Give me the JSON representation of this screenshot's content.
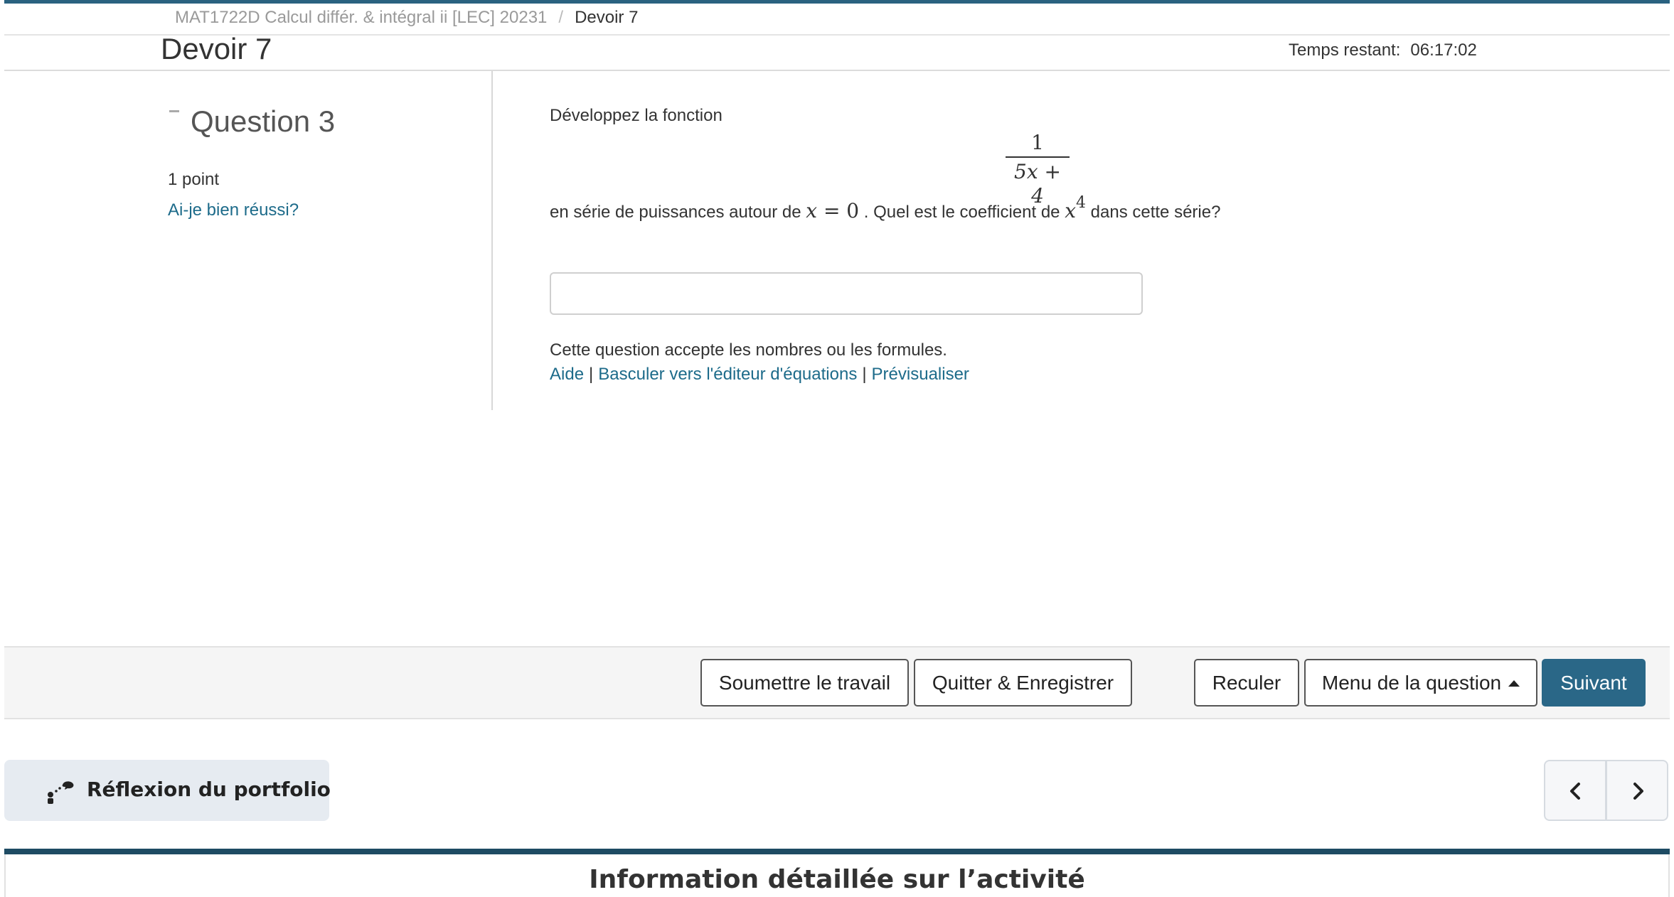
{
  "breadcrumb": {
    "course": "MAT1722D Calcul différ. & intégral ii [LEC] 20231",
    "separator": "/",
    "current": "Devoir 7"
  },
  "header": {
    "title": "Devoir 7",
    "timer_label": "Temps restant:",
    "timer_value": "06:17:02"
  },
  "question_panel": {
    "collapse_symbol": "-",
    "title": "Question 3",
    "points": "1 point",
    "self_check_link": "Ai-je bien réussi?"
  },
  "question": {
    "intro": "Développez la fonction",
    "fraction_numerator": "1",
    "fraction_denominator": "5x + 4",
    "body_part1": "en série de puissances autour de",
    "math_point_var": "x",
    "math_point_eq": " = 0",
    "body_part2": ". Quel est le coefficient de",
    "math_power_var": "x",
    "math_power_exp": "4",
    "body_part3": "dans cette série?",
    "answer_value": "",
    "accept_note": "Cette question accepte les nombres ou les formules.",
    "links": {
      "help": "Aide",
      "separator": "|",
      "equation_editor": "Basculer vers l'éditeur d'équations",
      "preview": "Prévisualiser"
    }
  },
  "buttons": {
    "submit": "Soumettre le travail",
    "quit_save": "Quitter & Enregistrer",
    "back": "Reculer",
    "question_menu": "Menu de la question",
    "next": "Suivant"
  },
  "portfolio": {
    "label": "Réflexion du portfolio",
    "icon": "portfolio-reflection-icon"
  },
  "pager": {
    "prev_icon": "chevron-left-icon",
    "next_icon": "chevron-right-icon"
  },
  "bottom": {
    "heading": "Information détaillée sur l’activité"
  },
  "colors": {
    "accent": "#2a6280",
    "link": "#1d6b8a",
    "primary_button": "#2a6787",
    "bottom_bar": "#1e4b63"
  }
}
